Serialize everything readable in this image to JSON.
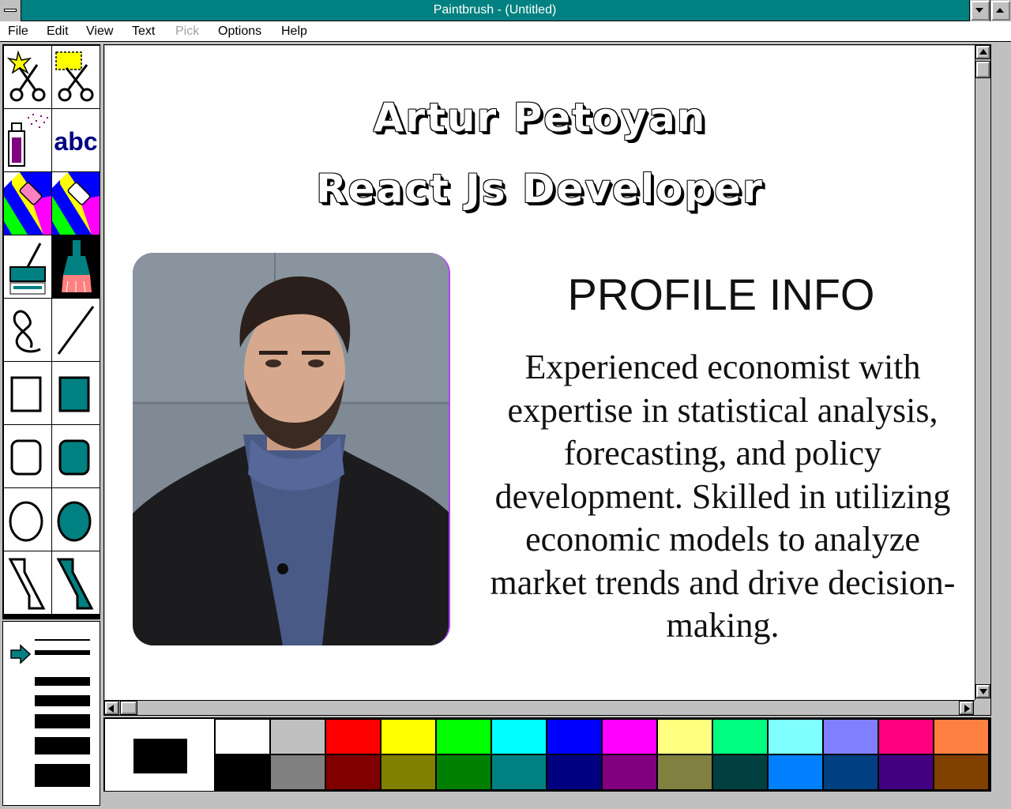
{
  "window": {
    "title": "Paintbrush - (Untitled)"
  },
  "menu": [
    {
      "label": "File",
      "enabled": true
    },
    {
      "label": "Edit",
      "enabled": true
    },
    {
      "label": "View",
      "enabled": true
    },
    {
      "label": "Text",
      "enabled": true
    },
    {
      "label": "Pick",
      "enabled": false
    },
    {
      "label": "Options",
      "enabled": true
    },
    {
      "label": "Help",
      "enabled": true
    }
  ],
  "tools": [
    {
      "name": "scissors-tool",
      "icon": "star-scissors-icon"
    },
    {
      "name": "pick-tool",
      "icon": "rect-scissors-icon"
    },
    {
      "name": "airbrush-tool",
      "icon": "spray-can-icon"
    },
    {
      "name": "text-tool",
      "icon": "text-abc-icon",
      "label": "abc"
    },
    {
      "name": "color-eraser-tool",
      "icon": "color-eraser-icon"
    },
    {
      "name": "eraser-tool",
      "icon": "eraser-icon"
    },
    {
      "name": "paint-roller-tool",
      "icon": "paint-roller-icon"
    },
    {
      "name": "brush-tool",
      "icon": "brush-icon",
      "selected": true
    },
    {
      "name": "curve-tool",
      "icon": "curve-icon"
    },
    {
      "name": "line-tool",
      "icon": "line-icon"
    },
    {
      "name": "box-tool",
      "icon": "box-icon"
    },
    {
      "name": "filled-box-tool",
      "icon": "filled-box-icon"
    },
    {
      "name": "rounded-box-tool",
      "icon": "rounded-box-icon"
    },
    {
      "name": "filled-rounded-box-tool",
      "icon": "filled-rounded-box-icon"
    },
    {
      "name": "circle-tool",
      "icon": "circle-icon"
    },
    {
      "name": "filled-circle-tool",
      "icon": "filled-circle-icon"
    },
    {
      "name": "polygon-tool",
      "icon": "polygon-icon"
    },
    {
      "name": "filled-polygon-tool",
      "icon": "filled-polygon-icon"
    }
  ],
  "line_sizes": {
    "count": 7,
    "selected": 1
  },
  "canvas": {
    "heading_line1": "Artur Petoyan",
    "heading_line2": "React Js Developer",
    "profile_heading": "PROFILE INFO",
    "profile_text": "Experienced economist with expertise in statistical analysis, forecasting, and policy development. Skilled in utilizing economic models to analyze market trends and drive decision-making."
  },
  "palette": {
    "foreground": "#000000",
    "background": "#ffffff",
    "colors_top": [
      "#ffffff",
      "#c0c0c0",
      "#ff0000",
      "#ffff00",
      "#00ff00",
      "#00ffff",
      "#0000ff",
      "#ff00ff",
      "#ffff80",
      "#00ff80",
      "#80ffff",
      "#8080ff",
      "#ff0080",
      "#ff8040"
    ],
    "colors_bottom": [
      "#000000",
      "#808080",
      "#800000",
      "#808000",
      "#008000",
      "#008080",
      "#000080",
      "#800080",
      "#808040",
      "#004040",
      "#0080ff",
      "#004080",
      "#400080",
      "#804000"
    ]
  }
}
